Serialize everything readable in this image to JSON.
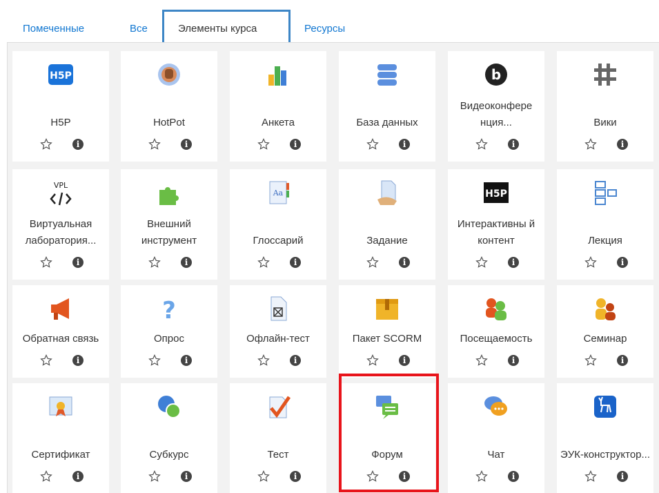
{
  "tabs": [
    {
      "label": "Помеченные"
    },
    {
      "label": "Все"
    },
    {
      "label": "Элементы курса"
    },
    {
      "label": "Ресурсы"
    }
  ],
  "active_tab": "Элементы курса",
  "activities": [
    {
      "label": "H5P",
      "icon": "h5p-icon"
    },
    {
      "label": "HotPot",
      "icon": "hotpot-icon"
    },
    {
      "label": "Анкета",
      "icon": "survey-chart-icon"
    },
    {
      "label": "База данных",
      "icon": "database-icon"
    },
    {
      "label": "Видеоконфере нция...",
      "icon": "bigbluebutton-icon"
    },
    {
      "label": "Вики",
      "icon": "wiki-icon"
    },
    {
      "label": "Виртуальная лаборатория...",
      "icon": "vpl-icon"
    },
    {
      "label": "Внешний инструмент",
      "icon": "puzzle-icon"
    },
    {
      "label": "Глоссарий",
      "icon": "glossary-icon"
    },
    {
      "label": "Задание",
      "icon": "assignment-icon"
    },
    {
      "label": "Интерактивны й контент",
      "icon": "h5p-dark-icon"
    },
    {
      "label": "Лекция",
      "icon": "lesson-icon"
    },
    {
      "label": "Обратная связь",
      "icon": "megaphone-icon"
    },
    {
      "label": "Опрос",
      "icon": "question-icon"
    },
    {
      "label": "Офлайн-тест",
      "icon": "offline-quiz-icon"
    },
    {
      "label": "Пакет SCORM",
      "icon": "scorm-package-icon"
    },
    {
      "label": "Посещаемость",
      "icon": "attendance-icon"
    },
    {
      "label": "Семинар",
      "icon": "workshop-icon"
    },
    {
      "label": "Сертификат",
      "icon": "certificate-icon"
    },
    {
      "label": "Субкурс",
      "icon": "subcourse-icon"
    },
    {
      "label": "Тест",
      "icon": "quiz-check-icon"
    },
    {
      "label": "Форум",
      "icon": "forum-icon"
    },
    {
      "label": "Чат",
      "icon": "chat-icon"
    },
    {
      "label": "ЭУК-конструктор...",
      "icon": "deer-icon"
    }
  ],
  "highlighted_activity": "Форум",
  "colors": {
    "link": "#1177d1",
    "tab_border": "#3d86c6",
    "highlight": "#e8141b",
    "background": "#f2f2f2"
  }
}
